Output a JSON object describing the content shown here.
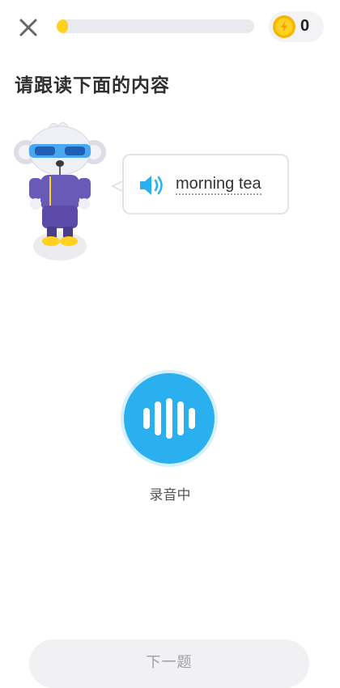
{
  "header": {
    "close_icon": "close-icon",
    "progress_fraction": 0.03,
    "progress_color": "#ffd21f",
    "coin_icon": "coin-icon",
    "coins": "0"
  },
  "prompt": {
    "instruction": "请跟读下面的内容",
    "mascot": "koala-mascot",
    "speaker_icon": "speaker-icon",
    "phrase": "morning tea"
  },
  "recorder": {
    "icon": "waveform-icon",
    "accent_color": "#2ab0ef",
    "status": "录音中"
  },
  "footer": {
    "next_label": "下一题"
  }
}
